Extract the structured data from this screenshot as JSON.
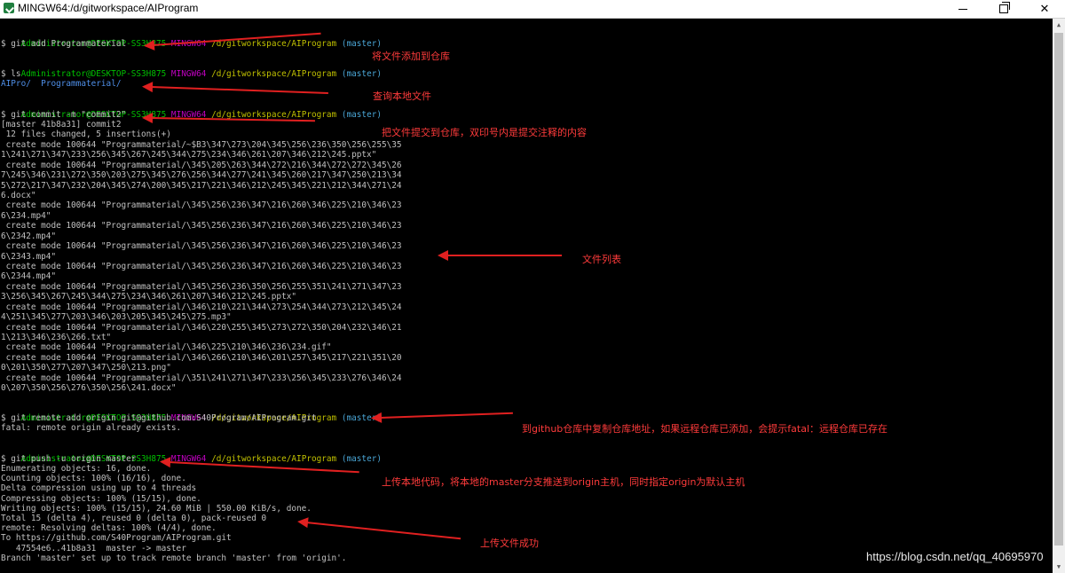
{
  "window": {
    "title": "MINGW64:/d/gitworkspace/AIProgram",
    "icon": "git-bash-icon",
    "buttons": {
      "minimize": "─",
      "maximize": "□",
      "close": "✕"
    }
  },
  "prompt": {
    "user": "Administrator@DESKTOP-SS3H875",
    "system": "MINGW64",
    "path": "/d/gitworkspace/AIProgram",
    "branch": "(master)"
  },
  "colors": {
    "background": "#000000",
    "text": "#c0c0c0",
    "user": "#00c000",
    "system": "#c000c0",
    "path": "#c0c000",
    "branch": "#4aa6d6",
    "annotation": "#ff3b3b"
  },
  "terminal": {
    "cmd1": "$ git add Programmaterial",
    "cmd2": "$ ls",
    "ls_dir1": "AIPro/",
    "ls_dir2": "Programmaterial/",
    "cmd3": "$ git commit -m \"commit2\"",
    "commit_out": [
      "[master 41b8a31] commit2",
      " 12 files changed, 5 insertions(+)",
      " create mode 100644 \"Programmaterial/~$B3\\347\\273\\204\\345\\256\\236\\350\\256\\255\\35",
      "1\\241\\271\\347\\233\\256\\345\\267\\245\\344\\275\\234\\346\\261\\207\\346\\212\\245.pptx\"",
      " create mode 100644 \"Programmaterial/\\345\\205\\263\\344\\272\\216\\344\\272\\272\\345\\26",
      "7\\245\\346\\231\\272\\350\\203\\275\\345\\276\\256\\344\\277\\241\\345\\260\\217\\347\\250\\213\\34",
      "5\\272\\217\\347\\232\\204\\345\\274\\200\\345\\217\\221\\346\\212\\245\\345\\221\\212\\344\\271\\24",
      "6.docx\"",
      " create mode 100644 \"Programmaterial/\\345\\256\\236\\347\\216\\260\\346\\225\\210\\346\\23",
      "6\\234.mp4\"",
      " create mode 100644 \"Programmaterial/\\345\\256\\236\\347\\216\\260\\346\\225\\210\\346\\23",
      "6\\2342.mp4\"",
      " create mode 100644 \"Programmaterial/\\345\\256\\236\\347\\216\\260\\346\\225\\210\\346\\23",
      "6\\2343.mp4\"",
      " create mode 100644 \"Programmaterial/\\345\\256\\236\\347\\216\\260\\346\\225\\210\\346\\23",
      "6\\2344.mp4\"",
      " create mode 100644 \"Programmaterial/\\345\\256\\236\\350\\256\\255\\351\\241\\271\\347\\23",
      "3\\256\\345\\267\\245\\344\\275\\234\\346\\261\\207\\346\\212\\245.pptx\"",
      " create mode 100644 \"Programmaterial/\\346\\210\\221\\344\\273\\254\\344\\273\\212\\345\\24",
      "4\\251\\345\\277\\203\\346\\203\\205\\345\\245\\275.mp3\"",
      " create mode 100644 \"Programmaterial/\\346\\220\\255\\345\\273\\272\\350\\204\\232\\346\\21",
      "1\\213\\346\\236\\266.txt\"",
      " create mode 100644 \"Programmaterial/\\346\\225\\210\\346\\236\\234.gif\"",
      " create mode 100644 \"Programmaterial/\\346\\266\\210\\346\\201\\257\\345\\217\\221\\351\\20",
      "0\\201\\350\\277\\207\\347\\250\\213.png\"",
      " create mode 100644 \"Programmaterial/\\351\\241\\271\\347\\233\\256\\345\\233\\276\\346\\24",
      "0\\207\\350\\256\\276\\350\\256\\241.docx\""
    ],
    "cmd4": "$ git remote add origin git@github.com:S40Program/AIProgram.git",
    "remote_out": "fatal: remote origin already exists.",
    "cmd5": "$ git push -u origin master",
    "push_out": [
      "Enumerating objects: 16, done.",
      "Counting objects: 100% (16/16), done.",
      "Delta compression using up to 4 threads",
      "Compressing objects: 100% (15/15), done.",
      "Writing objects: 100% (15/15), 24.60 MiB | 550.00 KiB/s, done.",
      "Total 15 (delta 4), reused 0 (delta 0), pack-reused 0",
      "remote: Resolving deltas: 100% (4/4), done.",
      "To https://github.com/S40Program/AIProgram.git",
      "   47554e6..41b8a31  master -> master",
      "Branch 'master' set up to track remote branch 'master' from 'origin'."
    ]
  },
  "annotations": {
    "add": "将文件添加到仓库",
    "ls": "查询本地文件",
    "commit": "把文件提交到仓库，双印号内是提交注释的内容",
    "files": "文件列表",
    "remote": "到github仓库中复制仓库地址，如果远程仓库已添加，会提示fatal：远程仓库已存在",
    "push": "上传本地代码，将本地的master分支推送到origin主机，同时指定origin为默认主机",
    "success": "上传文件成功"
  },
  "watermark": "https://blog.csdn.net/qq_40695970"
}
